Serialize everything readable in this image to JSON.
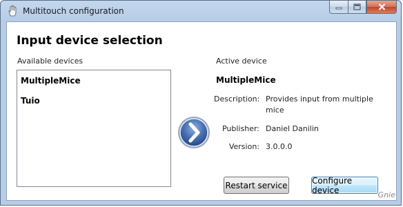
{
  "window": {
    "title": "Multitouch configuration"
  },
  "heading": "Input device selection",
  "available": {
    "label": "Available devices",
    "items": [
      "MultipleMice",
      "Tuio"
    ]
  },
  "active": {
    "label": "Active device",
    "name": "MultipleMice",
    "description_key": "Description:",
    "description_val": "Provides input from multiple mice",
    "publisher_key": "Publisher:",
    "publisher_val": "Daniel Danilin",
    "version_key": "Version:",
    "version_val": "3.0.0.0"
  },
  "buttons": {
    "restart": "Restart service",
    "configure": "Configure device"
  },
  "watermark": "Gnie",
  "icons": {
    "title": "hand-icon",
    "arrow": "arrow-right-icon"
  },
  "colors": {
    "titlebar": "#c3d7ee",
    "arrow": "#4a6fb0",
    "close": "#c0442c"
  }
}
